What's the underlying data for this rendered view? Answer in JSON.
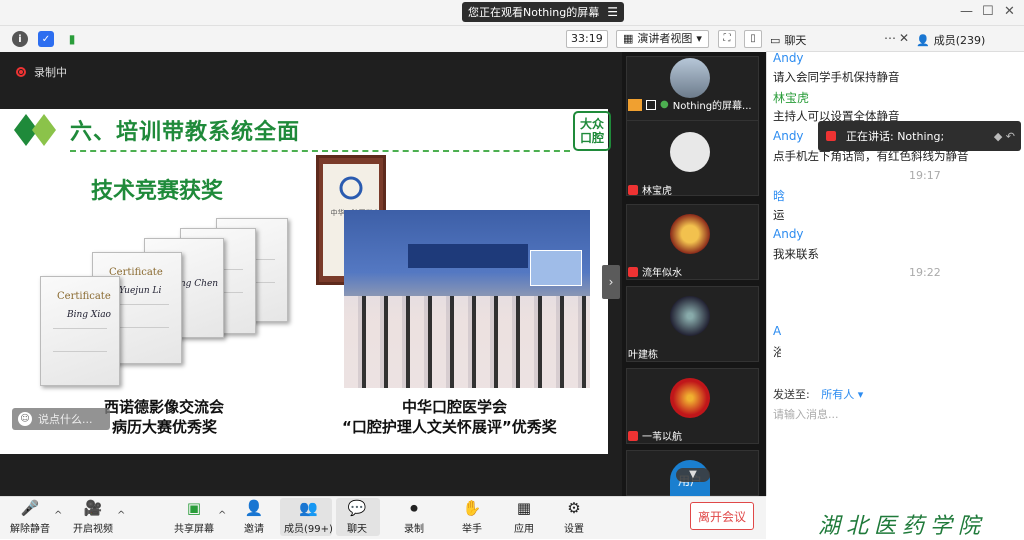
{
  "share_banner": {
    "text": "您正在观看Nothing的屏幕",
    "menu_icon": "menu-icon"
  },
  "toolbar": {
    "timer": "33:19",
    "view_mode": "演讲者视图"
  },
  "recording": {
    "label": "录制中"
  },
  "slide": {
    "title": "六、培训带教系统全面",
    "logo_line1": "大众",
    "logo_line2": "口腔",
    "subtitle": "技术竞赛获奖",
    "certificate_label": "Certificate",
    "cert_signatures": [
      "Bing Xiao",
      "Yuejun Li",
      "Ling Chen"
    ],
    "award_org": "中华口腔医学会",
    "caption_left_1": "西诺德影像交流会",
    "caption_left_2": "病历大赛优秀奖",
    "caption_right_1": "中华口腔医学会",
    "caption_right_2": "“口腔护理人文关怀展评”优秀奖"
  },
  "say_input": {
    "placeholder": "说点什么..."
  },
  "gallery": {
    "tiles": [
      {
        "label": "Nothing的屏幕..."
      },
      {
        "label": "林宝虎"
      },
      {
        "label": "流年似水"
      },
      {
        "label": "叶建栋"
      },
      {
        "label": "一苇以航"
      },
      {
        "label": "用户"
      }
    ]
  },
  "chat": {
    "tab_chat": "聊天",
    "tab_members": "成员(239)",
    "messages": [
      {
        "name": "Andy",
        "text": "请入会同学手机保持静音"
      },
      {
        "name": "林宝虎",
        "text": "主持人可以设置全体静音"
      },
      {
        "name": "Andy",
        "text": "点手机左下角话筒，有红色斜线为静音"
      },
      {
        "time": "19:17"
      },
      {
        "name": "晗",
        "text": "运"
      },
      {
        "name": "Andy",
        "text": "我来联系"
      },
      {
        "time": "19:22"
      },
      {
        "name": "A",
        "text": "浴"
      }
    ],
    "speaking": "正在讲话: Nothing;",
    "send_to_label": "发送至:",
    "send_to_target": "所有人",
    "input_placeholder": "请输入消息..."
  },
  "bottom": {
    "unmute": "解除静音",
    "start_video": "开启视频",
    "share_screen": "共享屏幕",
    "invite": "邀请",
    "members": "成员(99+)",
    "chat": "聊天",
    "record": "录制",
    "raise_hand": "举手",
    "apps": "应用",
    "settings": "设置",
    "leave": "离开会议"
  },
  "brand": "湖北医药学院"
}
